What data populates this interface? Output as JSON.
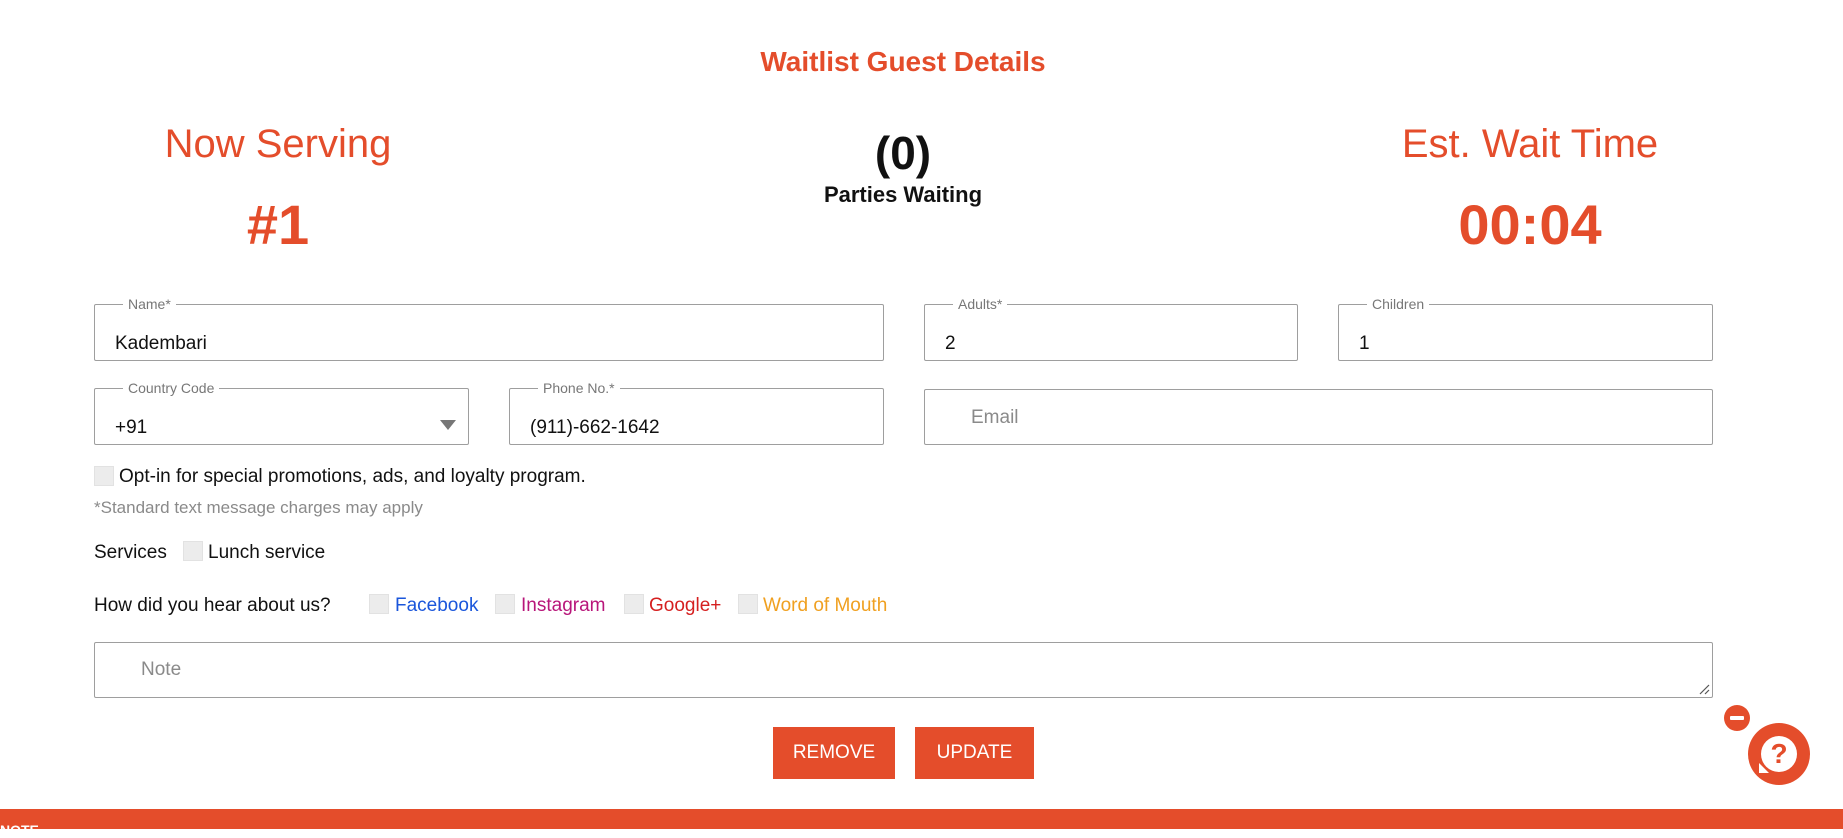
{
  "page": {
    "title": "Waitlist Guest Details"
  },
  "stats": {
    "now_serving_label": "Now Serving",
    "now_serving_value": "#1",
    "parties_waiting_count": "(0)",
    "parties_waiting_label": "Parties Waiting",
    "wait_time_label": "Est. Wait Time",
    "wait_time_value": "00:04"
  },
  "form": {
    "name": {
      "label": "Name*",
      "value": "Kadembari"
    },
    "adults": {
      "label": "Adults*",
      "value": "2"
    },
    "children": {
      "label": "Children",
      "value": "1"
    },
    "country_code": {
      "label": "Country Code",
      "value": "+91"
    },
    "phone": {
      "label": "Phone No.*",
      "value": "(911)-662-1642"
    },
    "email": {
      "placeholder": "Email"
    },
    "optin_label": "Opt-in for special promotions, ads, and loyalty program.",
    "sms_note": "*Standard text message charges may apply",
    "services_label": "Services",
    "services": [
      {
        "label": "Lunch service"
      }
    ],
    "source_label": "How did you hear about us?",
    "sources": [
      {
        "label": "Facebook",
        "color": "#1a56db"
      },
      {
        "label": "Instagram",
        "color": "#b8167a"
      },
      {
        "label": "Google+",
        "color": "#d51f1f"
      },
      {
        "label": "Word of Mouth",
        "color": "#f0a020"
      }
    ],
    "note": {
      "placeholder": "Note"
    }
  },
  "actions": {
    "remove_label": "REMOVE",
    "update_label": "UPDATE"
  },
  "colors": {
    "accent": "#e44d2b"
  },
  "icons": {
    "help": "question-chat-icon",
    "close": "minus-circle-icon",
    "dropdown": "caret-down-icon",
    "resize": "resize-handle-icon"
  },
  "footer": {
    "text": "NOTE"
  }
}
